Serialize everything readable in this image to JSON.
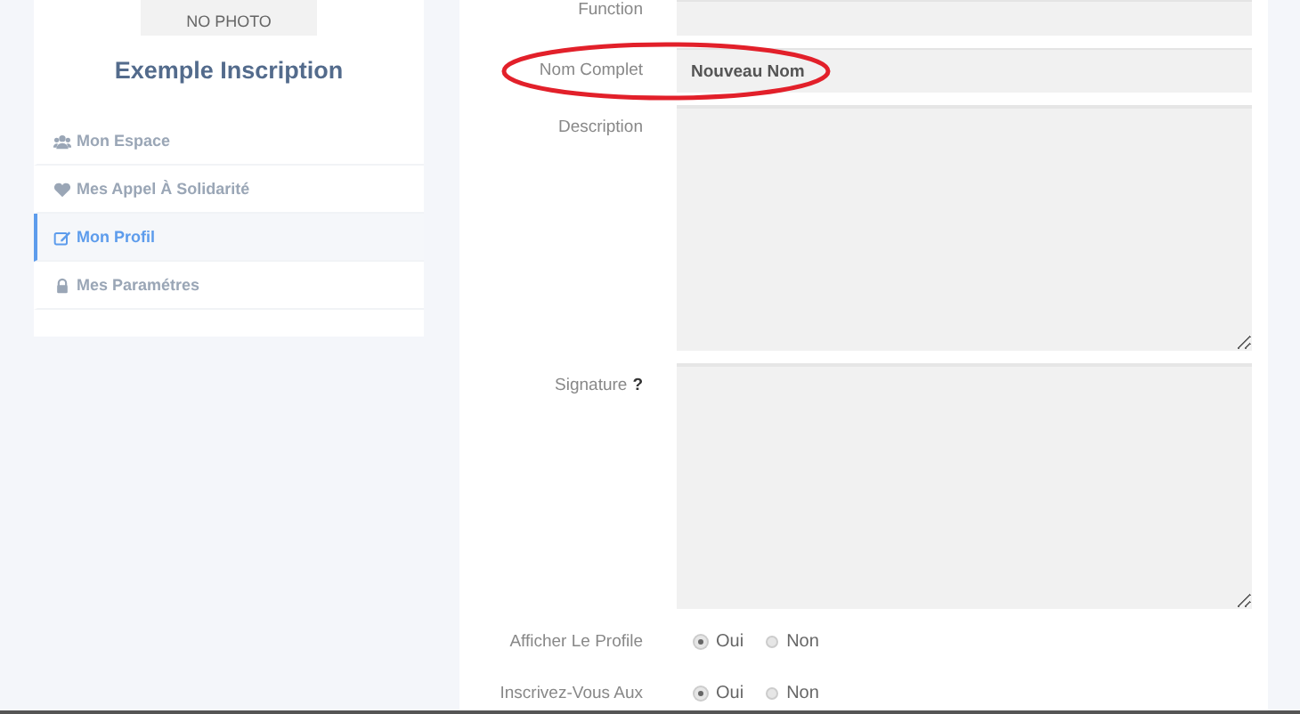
{
  "sidebar": {
    "photo_label": "NO PHOTO",
    "name": "Exemple Inscription",
    "items": [
      {
        "label": "Mon Espace",
        "selected": false
      },
      {
        "label": "Mes Appel À Solidarité",
        "selected": false
      },
      {
        "label": "Mon Profil",
        "selected": true
      },
      {
        "label": "Mes Paramétres",
        "selected": false
      }
    ]
  },
  "form": {
    "fields": [
      {
        "kind": "text",
        "label": "Function"
      },
      {
        "kind": "text",
        "label": "Nom Complet",
        "value": "Nouveau Nom",
        "highlighted": true
      },
      {
        "kind": "textarea",
        "label": "Description"
      },
      {
        "kind": "textarea",
        "label": "Signature",
        "help": "?"
      },
      {
        "kind": "radio",
        "label": "Afficher Le Profile",
        "options": [
          {
            "label": "Oui",
            "selected": true
          },
          {
            "label": "Non",
            "selected": false
          }
        ]
      },
      {
        "kind": "radio",
        "label": "Inscrivez-Vous Aux",
        "options": [
          {
            "label": "Oui",
            "selected": true
          },
          {
            "label": "Non",
            "selected": false
          }
        ]
      }
    ]
  }
}
